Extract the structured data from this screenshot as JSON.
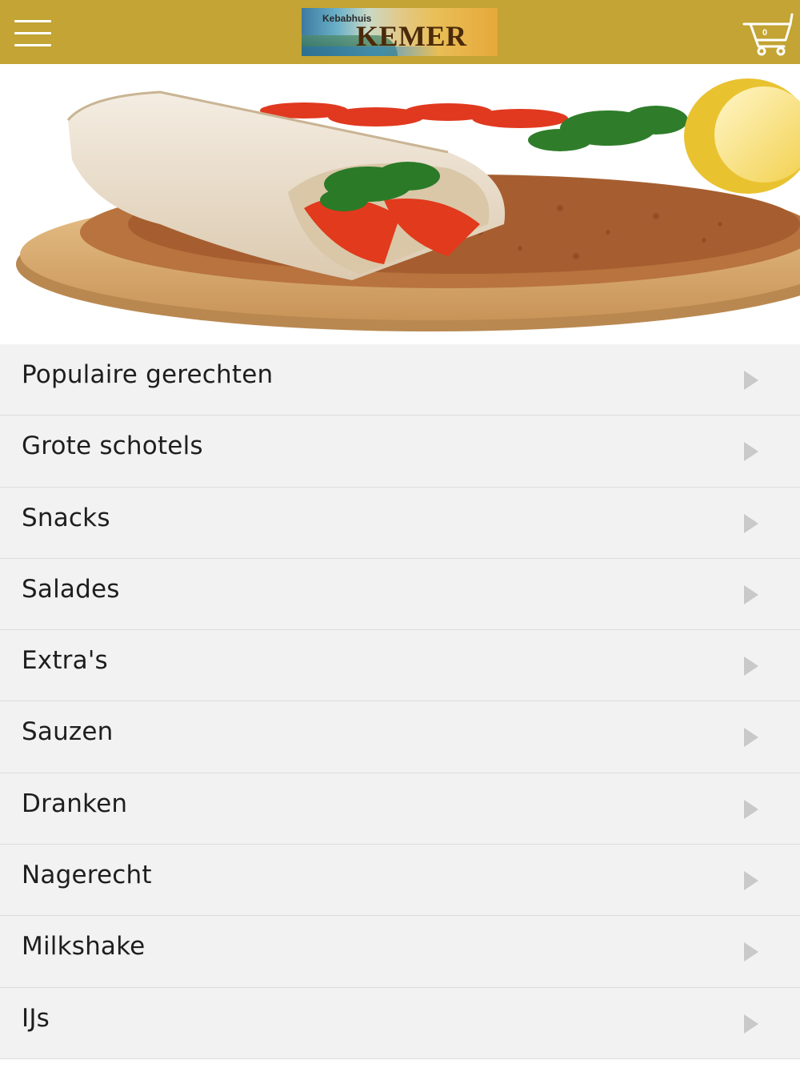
{
  "header": {
    "logo_small": "Kebabhuis",
    "logo_big": "KEMER",
    "cart_count": "0",
    "icons": {
      "menu": "hamburger-icon",
      "cart": "shopping-cart-icon"
    }
  },
  "hero": {
    "subject": "lahmacun-wrap-on-wooden-board"
  },
  "menu": {
    "items": [
      {
        "label": "Populaire gerechten"
      },
      {
        "label": "Grote schotels"
      },
      {
        "label": "Snacks"
      },
      {
        "label": "Salades"
      },
      {
        "label": "Extra's"
      },
      {
        "label": "Sauzen"
      },
      {
        "label": "Dranken"
      },
      {
        "label": "Nagerecht"
      },
      {
        "label": "Milkshake"
      },
      {
        "label": "IJs"
      }
    ],
    "arrow_icon": "chevron-right-icon"
  },
  "colors": {
    "header_bg": "#c3a434",
    "list_bg": "#f2f2f2",
    "divider": "#dcdcdc",
    "text": "#1e1e1e",
    "arrow": "#c9c9c9"
  }
}
